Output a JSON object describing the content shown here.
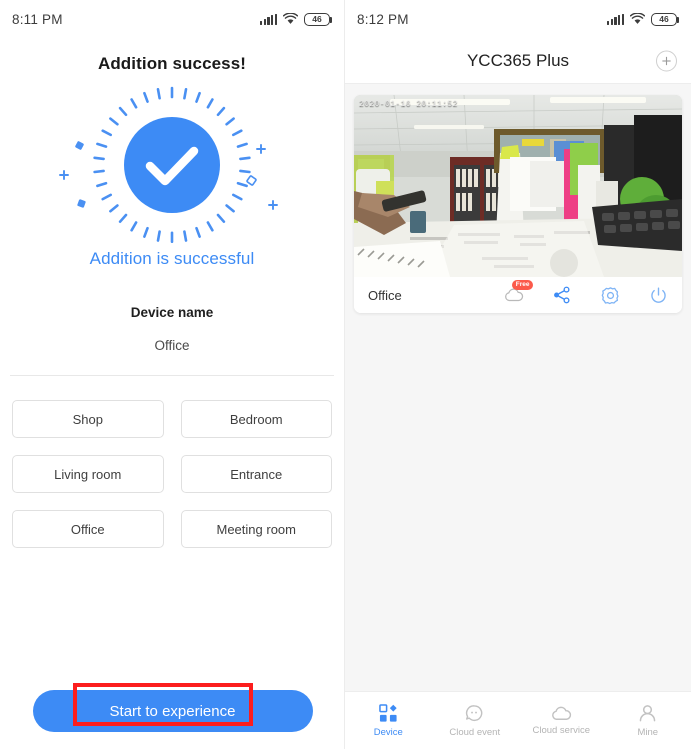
{
  "colors": {
    "accent": "#3d8bf5",
    "annotation": "#fc1d1d",
    "badge": "#fb5a4b",
    "inactive_tab": "#b4b4b4",
    "page_bg": "#f6f6f6"
  },
  "left_screen": {
    "status_bar": {
      "time": "8:11 PM",
      "signal_icon": "signal-bars-icon",
      "wifi_icon": "wifi-icon",
      "battery_icon": "battery-icon",
      "battery_level": "46"
    },
    "heading": "Addition success!",
    "success_icon": "check-circle-icon",
    "success_message": "Addition is successful",
    "device_name_label": "Device name",
    "device_name_value": "Office",
    "rooms": [
      "Shop",
      "Bedroom",
      "Living room",
      "Entrance",
      "Office",
      "Meeting room"
    ],
    "cta_label": "Start to experience",
    "annotation": "red-highlight-box"
  },
  "right_screen": {
    "status_bar": {
      "time": "8:12 PM",
      "signal_icon": "signal-bars-icon",
      "wifi_icon": "wifi-icon",
      "battery_icon": "battery-icon",
      "battery_level": "46"
    },
    "app_title": "YCC365 Plus",
    "add_button_icon": "plus-icon",
    "camera_card": {
      "video_timestamp": "2020-01-16 20:11:52",
      "device_label": "Office",
      "actions": [
        {
          "icon": "cloud-icon",
          "badge": "Free"
        },
        {
          "icon": "share-icon",
          "badge": ""
        },
        {
          "icon": "settings-gear-icon",
          "badge": ""
        },
        {
          "icon": "power-icon",
          "badge": ""
        }
      ]
    },
    "tabs": [
      {
        "label": "Device",
        "icon": "grid-device-icon",
        "active": true
      },
      {
        "label": "Cloud event",
        "icon": "chat-bubble-icon",
        "active": false
      },
      {
        "label": "Cloud service",
        "icon": "cloud-icon",
        "active": false
      },
      {
        "label": "Mine",
        "icon": "person-icon",
        "active": false
      }
    ]
  }
}
